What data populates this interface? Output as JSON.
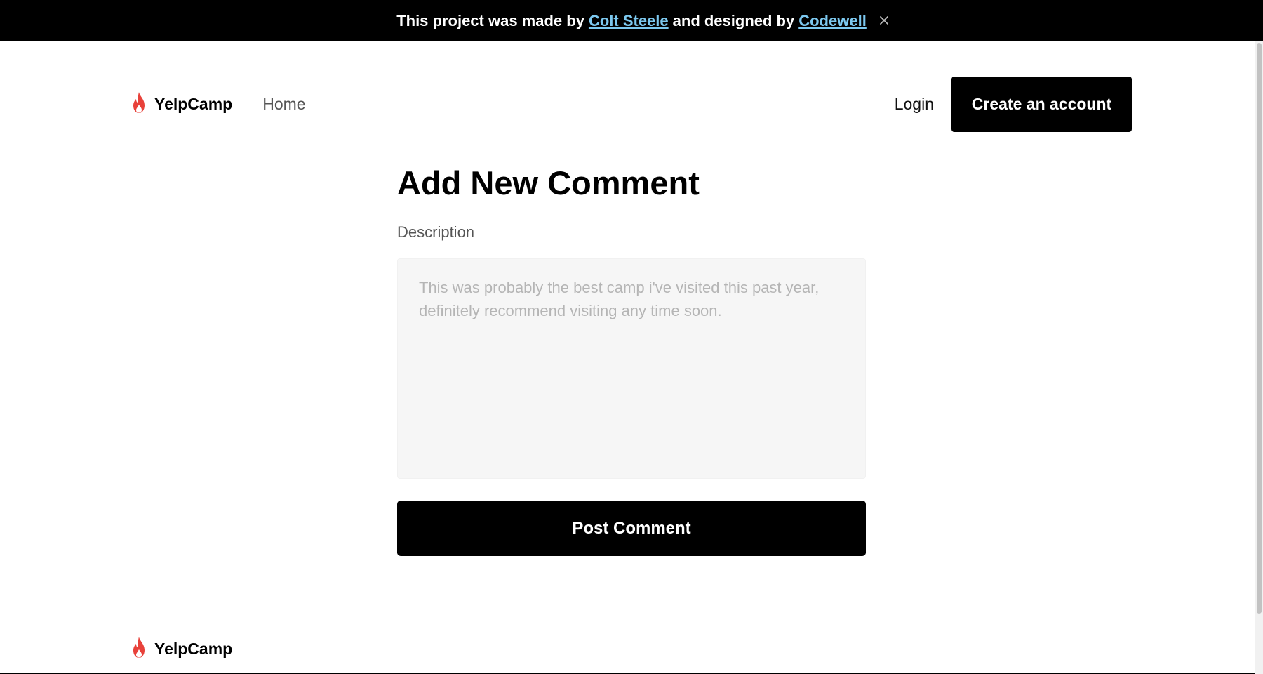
{
  "banner": {
    "prefix": "This project was made by",
    "author_link": "Colt Steele",
    "middle": "and designed by",
    "designer_link": "Codewell",
    "close_icon": "close-icon"
  },
  "nav": {
    "brand": "YelpCamp",
    "brand_icon": "flame-icon",
    "home": "Home",
    "login": "Login",
    "create_account": "Create an account"
  },
  "form": {
    "title": "Add New Comment",
    "description_label": "Description",
    "description_placeholder": "This was probably the best camp i've visited this past year, definitely recommend visiting any time soon.",
    "description_value": "",
    "submit": "Post Comment"
  },
  "footer": {
    "brand": "YelpCamp",
    "brand_icon": "flame-icon"
  },
  "colors": {
    "brand_flame": "#e8413a",
    "link": "#7cc8ef",
    "button_bg": "#000000",
    "input_bg": "#f6f6f6"
  }
}
